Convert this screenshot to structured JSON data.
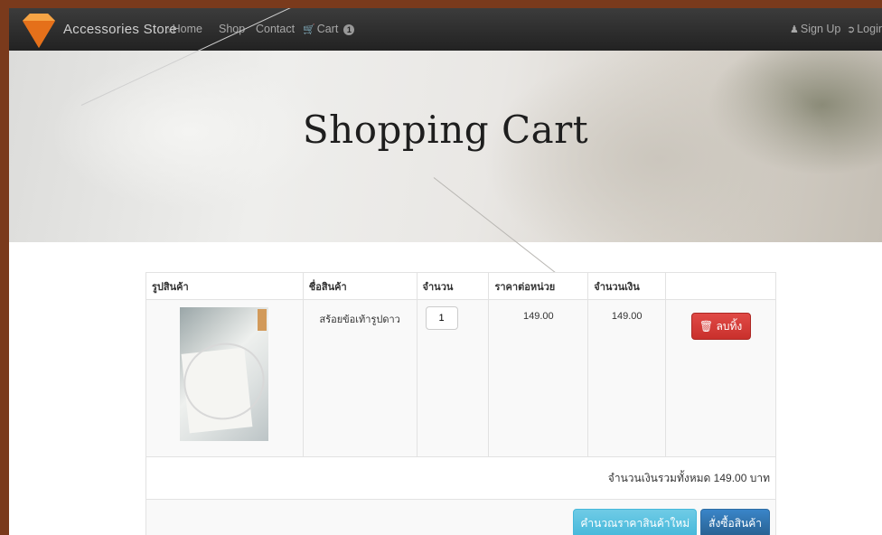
{
  "navbar": {
    "brand": "Accessories Store",
    "home": "Home",
    "shop": "Shop",
    "contact": "Contact",
    "cart": "Cart",
    "cart_count": "1",
    "signup": "Sign Up",
    "login": "Login"
  },
  "hero": {
    "title": "Shopping Cart"
  },
  "cart": {
    "headers": [
      "รูปสินค้า",
      "ชื่อสินค้า",
      "จำนวน",
      "ราคาต่อหน่วย",
      "จำนวนเงิน",
      ""
    ],
    "items": [
      {
        "name": "สร้อยข้อเท้ารูปดาว",
        "quantity": "1",
        "unit_price": "149.00",
        "amount": "149.00",
        "delete_label": "ลบทิ้ง"
      }
    ],
    "total_text": "จำนวนเงินรวมทั้งหมด 149.00 บาท",
    "recalc_label": "คำนวณราคาสินค้าใหม่",
    "order_label": "สั่งซื้อสินค้า"
  },
  "colors": {
    "danger": "#d9534f",
    "info": "#5bc0de",
    "primary": "#337ab7",
    "frame": "#7a3a1c"
  }
}
